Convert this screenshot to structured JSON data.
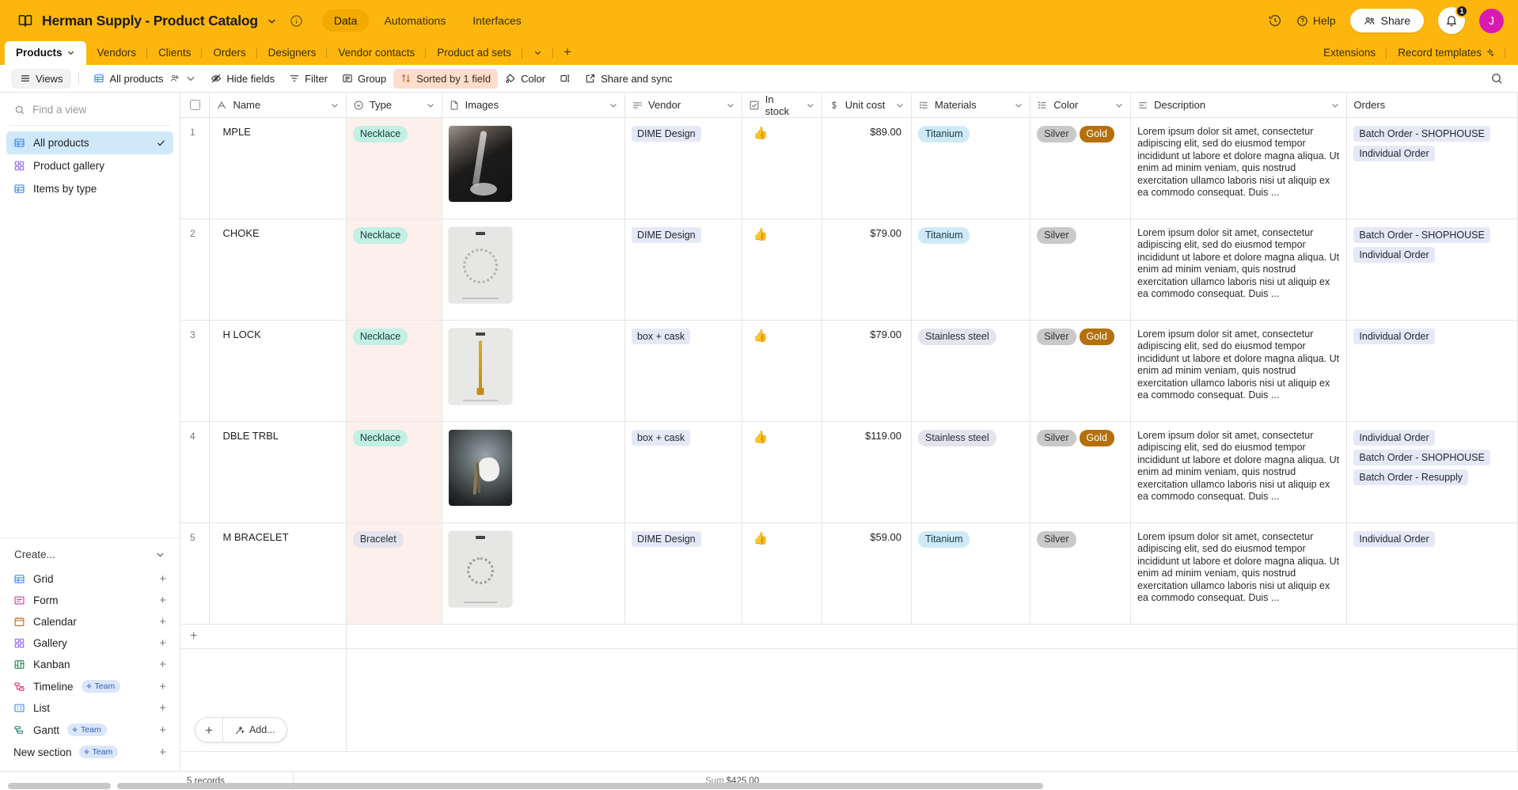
{
  "header": {
    "workspace_icon": "book-icon",
    "title": "Herman Supply - Product Catalog",
    "info_icon": "info-icon",
    "nav": [
      {
        "label": "Data",
        "active": true
      },
      {
        "label": "Automations",
        "active": false
      },
      {
        "label": "Interfaces",
        "active": false
      }
    ],
    "history_icon": "history-icon",
    "help_label": "Help",
    "share_label": "Share",
    "notification_count": "1",
    "avatar_initial": "J"
  },
  "table_tabs": {
    "tabs": [
      {
        "label": "Products",
        "active": true
      },
      {
        "label": "Vendors",
        "active": false
      },
      {
        "label": "Clients",
        "active": false
      },
      {
        "label": "Orders",
        "active": false
      },
      {
        "label": "Designers",
        "active": false
      },
      {
        "label": "Vendor contacts",
        "active": false
      },
      {
        "label": "Product ad sets",
        "active": false
      }
    ],
    "add_label": "+",
    "right": [
      {
        "label": "Extensions"
      },
      {
        "label": "Record templates"
      }
    ]
  },
  "toolbar": {
    "views_label": "Views",
    "view_name": "All products",
    "hide_fields_label": "Hide fields",
    "filter_label": "Filter",
    "group_label": "Group",
    "sorted_label": "Sorted by 1 field",
    "color_label": "Color",
    "row_height_icon": "row-height-icon",
    "share_sync_label": "Share and sync",
    "search_icon": "search-icon"
  },
  "sidebar": {
    "search_placeholder": "Find a view",
    "views": [
      {
        "label": "All products",
        "icon": "grid-icon",
        "active": true
      },
      {
        "label": "Product gallery",
        "icon": "gallery-icon",
        "active": false
      },
      {
        "label": "Items by type",
        "icon": "grid-icon",
        "active": false
      }
    ],
    "create_header": "Create...",
    "create_items": [
      {
        "label": "Grid",
        "icon": "grid-icon",
        "badge": null
      },
      {
        "label": "Form",
        "icon": "form-icon",
        "badge": null
      },
      {
        "label": "Calendar",
        "icon": "calendar-icon",
        "badge": null
      },
      {
        "label": "Gallery",
        "icon": "gallery-icon",
        "badge": null
      },
      {
        "label": "Kanban",
        "icon": "kanban-icon",
        "badge": null
      },
      {
        "label": "Timeline",
        "icon": "timeline-icon",
        "badge": "Team"
      },
      {
        "label": "List",
        "icon": "list-icon",
        "badge": null
      },
      {
        "label": "Gantt",
        "icon": "gantt-icon",
        "badge": "Team"
      }
    ],
    "new_section_label": "New section",
    "new_section_badge": "Team"
  },
  "grid": {
    "columns": [
      {
        "label": "Name",
        "icon": "text-field-icon"
      },
      {
        "label": "Type",
        "icon": "single-select-icon"
      },
      {
        "label": "Images",
        "icon": "attachment-icon"
      },
      {
        "label": "Vendor",
        "icon": "link-field-icon"
      },
      {
        "label": "In stock",
        "icon": "checkbox-field-icon"
      },
      {
        "label": "Unit cost",
        "icon": "currency-field-icon"
      },
      {
        "label": "Materials",
        "icon": "multi-select-icon"
      },
      {
        "label": "Color",
        "icon": "multi-select-icon"
      },
      {
        "label": "Description",
        "icon": "long-text-icon"
      },
      {
        "label": "Orders",
        "icon": "link-field-icon"
      }
    ],
    "description_text": "Lorem ipsum dolor sit amet, consectetur adipiscing elit, sed do eiusmod tempor incididunt ut labore et dolore magna aliqua. Ut enim ad minim veniam, quis nostrud exercitation ullamco laboris nisi ut aliquip ex ea commodo consequat. Duis ...",
    "rows": [
      {
        "num": "1",
        "name": "MPLE",
        "type": "Necklace",
        "vendor": "DIME Design",
        "in_stock": "👍",
        "unit_cost": "$89.00",
        "materials": [
          "Titanium"
        ],
        "colors": [
          "Silver",
          "Gold"
        ],
        "orders": [
          "Batch Order - SHOPHOUSE",
          "Individual Order"
        ],
        "image": "dark-photo-necklace-on-black-shirt"
      },
      {
        "num": "2",
        "name": "CHOKE",
        "type": "Necklace",
        "vendor": "DIME Design",
        "in_stock": "👍",
        "unit_cost": "$79.00",
        "materials": [
          "Titanium"
        ],
        "colors": [
          "Silver"
        ],
        "orders": [
          "Batch Order - SHOPHOUSE",
          "Individual Order"
        ],
        "image": "light-product-shot-round-choker"
      },
      {
        "num": "3",
        "name": "H LOCK",
        "type": "Necklace",
        "vendor": "box + cask",
        "in_stock": "👍",
        "unit_cost": "$79.00",
        "materials": [
          "Stainless steel"
        ],
        "colors": [
          "Silver",
          "Gold"
        ],
        "orders": [
          "Individual Order"
        ],
        "image": "light-product-shot-long-gold-chain"
      },
      {
        "num": "4",
        "name": "DBLE TRBL",
        "type": "Necklace",
        "vendor": "box + cask",
        "in_stock": "👍",
        "unit_cost": "$119.00",
        "materials": [
          "Stainless steel"
        ],
        "colors": [
          "Silver",
          "Gold"
        ],
        "orders": [
          "Individual Order",
          "Batch Order - SHOPHOUSE",
          "Batch Order - Resupply"
        ],
        "image": "dark-photo-hand-holding-chain"
      },
      {
        "num": "5",
        "name": "M BRACELET",
        "type": "Bracelet",
        "vendor": "DIME Design",
        "in_stock": "👍",
        "unit_cost": "$59.00",
        "materials": [
          "Titanium"
        ],
        "colors": [
          "Silver"
        ],
        "orders": [
          "Individual Order"
        ],
        "image": "light-product-shot-bracelet-circle"
      }
    ],
    "add_row_icon": "plus-icon",
    "add_record_plus": "+",
    "add_record_label": "Add..."
  },
  "footer": {
    "records_label": "5 records",
    "sum_label": "Sum",
    "sum_value": "$425.00"
  },
  "colors": {
    "brand_yellow": "#FDB60D",
    "accent_blue": "#cfe9fb",
    "sorted_peach": "#ffddcc",
    "avatar_magenta": "#D91AB0",
    "pill_teal": "#c2f0e4",
    "pill_gold": "#b5700c"
  }
}
